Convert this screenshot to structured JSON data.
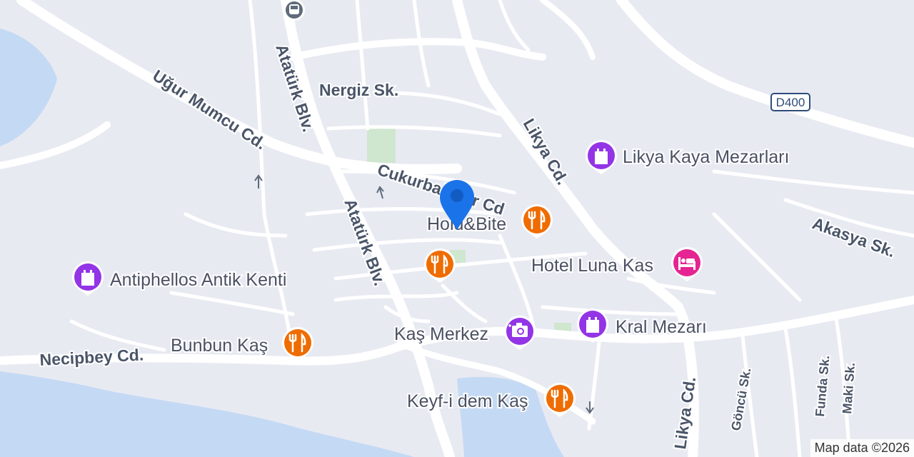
{
  "streets": {
    "ugur_mumcu": "Uğur Mumcu Cd.",
    "ataturk_north": "Atatürk Blv.",
    "ataturk_south": "Atatürk Blv.",
    "nergiz": "Nergiz Sk.",
    "cukurbaglilar": "Cukurbağlılar Cd",
    "likya_north": "Likya Cd.",
    "likya_south": "Likya Cd.",
    "akasya": "Akasya Sk.",
    "necipbey": "Necipbey Cd.",
    "goncu": "Göncü Sk.",
    "funda": "Funda Sk.",
    "maki": "Maki Sk."
  },
  "road_shield": "D400",
  "pois": {
    "likya_kaya": {
      "label": "Likya Kaya Mezarları",
      "icon": "castle-icon",
      "color": "#9334e6"
    },
    "antiphellos": {
      "label": "Antiphellos Antik Kenti",
      "icon": "castle-icon",
      "color": "#9334e6"
    },
    "kral_mezari": {
      "label": "Kral Mezarı",
      "icon": "castle-icon",
      "color": "#9334e6"
    },
    "hold_bite": {
      "label": "Hold&Bite",
      "icon": "restaurant-icon",
      "color": "#ef6c00"
    },
    "unnamed_restaurant": {
      "label": "",
      "icon": "restaurant-icon",
      "color": "#ef6c00"
    },
    "bunbun": {
      "label": "Bunbun Kaş",
      "icon": "restaurant-icon",
      "color": "#ef6c00"
    },
    "keyf_i_dem": {
      "label": "Keyf-i dem Kaş",
      "icon": "restaurant-icon",
      "color": "#ef6c00"
    },
    "hotel_luna": {
      "label": "Hotel Luna Kas",
      "icon": "hotel-icon",
      "color": "#e52592"
    },
    "kas_merkez": {
      "label": "Kaş Merkez",
      "icon": "camera-icon",
      "color": "#9334e6"
    }
  },
  "marker": {
    "icon": "location-pin-icon",
    "color": "#1a73e8"
  },
  "bus_stop": {
    "icon": "bus-icon"
  },
  "attribution": "Map data ©2026",
  "colors": {
    "land": "#e8eaf2",
    "water": "#c4d9f4",
    "park": "#cfe6cf",
    "road": "#ffffff"
  }
}
